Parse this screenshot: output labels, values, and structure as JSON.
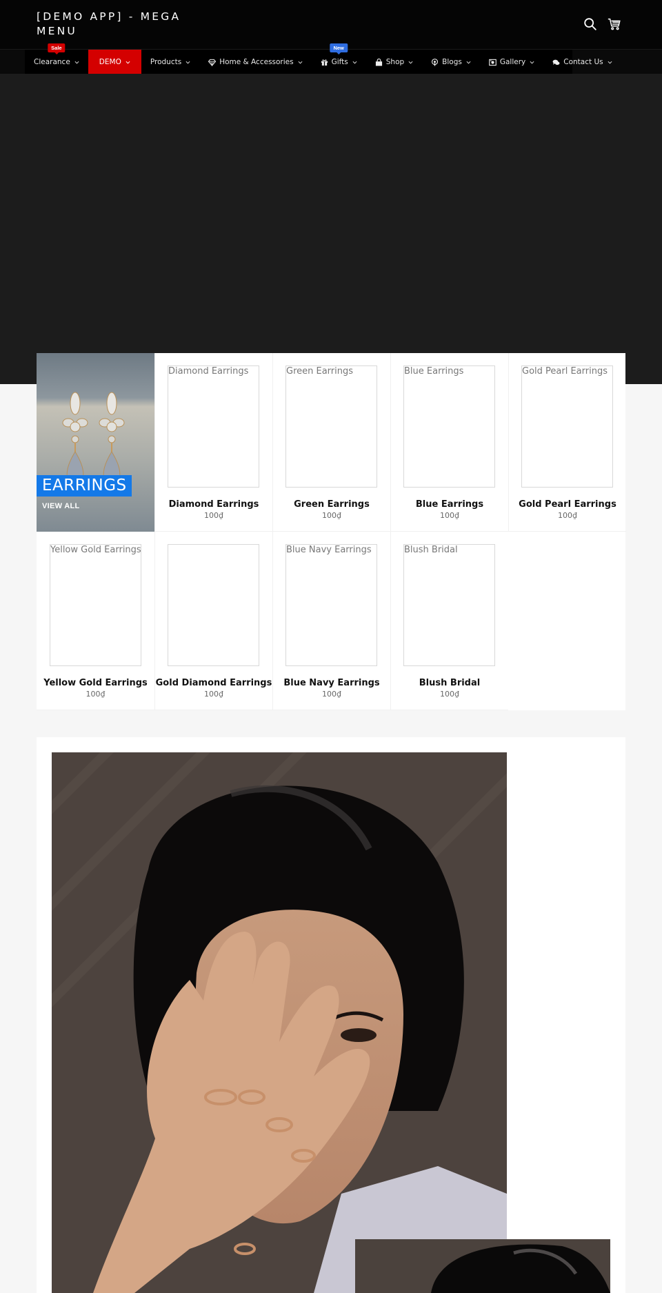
{
  "header": {
    "logo": "[DEMO APP] - MEGA MENU",
    "icons": [
      "search-icon",
      "cart-icon"
    ]
  },
  "nav": {
    "items": [
      {
        "label": "Clearance",
        "icon": null,
        "badge": "Sale",
        "active": false
      },
      {
        "label": "DEMO",
        "icon": null,
        "badge": null,
        "active": true
      },
      {
        "label": "Products",
        "icon": null,
        "badge": null,
        "active": false
      },
      {
        "label": "Home & Accessories",
        "icon": "diamond-icon",
        "badge": null,
        "active": false
      },
      {
        "label": "Gifts",
        "icon": "gift-icon",
        "badge": "New",
        "active": false
      },
      {
        "label": "Shop",
        "icon": "shopping-bag-icon",
        "badge": null,
        "active": false
      },
      {
        "label": "Blogs",
        "icon": "podcast-icon",
        "badge": null,
        "active": false
      },
      {
        "label": "Gallery",
        "icon": "image-icon",
        "badge": null,
        "active": false
      },
      {
        "label": "Contact Us",
        "icon": "comments-icon",
        "badge": null,
        "active": false
      }
    ],
    "colors": {
      "active_bg": "#d40000",
      "sale_badge": "#d40000",
      "new_badge": "#2f6de0"
    }
  },
  "collection": {
    "title": "EARRINGS",
    "link": "VIEW ALL",
    "title_bg": "#1479e8",
    "products": [
      {
        "name": "Diamond Earrings",
        "alt": "Diamond Earrings",
        "price": "100₫"
      },
      {
        "name": "Green Earrings",
        "alt": "Green Earrings",
        "price": "100₫"
      },
      {
        "name": "Blue Earrings",
        "alt": "Blue Earrings",
        "price": "100₫"
      },
      {
        "name": "Gold Pearl Earrings",
        "alt": "Gold Pearl Earrings",
        "price": "100₫"
      },
      {
        "name": "Yellow Gold Earrings",
        "alt": "Yellow Gold Earrings",
        "price": "100₫"
      },
      {
        "name": "Gold Diamond Earrings",
        "alt": "",
        "price": "100₫"
      },
      {
        "name": "Blue Navy Earrings",
        "alt": "Blue Navy Earrings",
        "price": "100₫"
      },
      {
        "name": "Blush Bridal",
        "alt": "Blush Bridal",
        "price": "100₫"
      }
    ]
  }
}
